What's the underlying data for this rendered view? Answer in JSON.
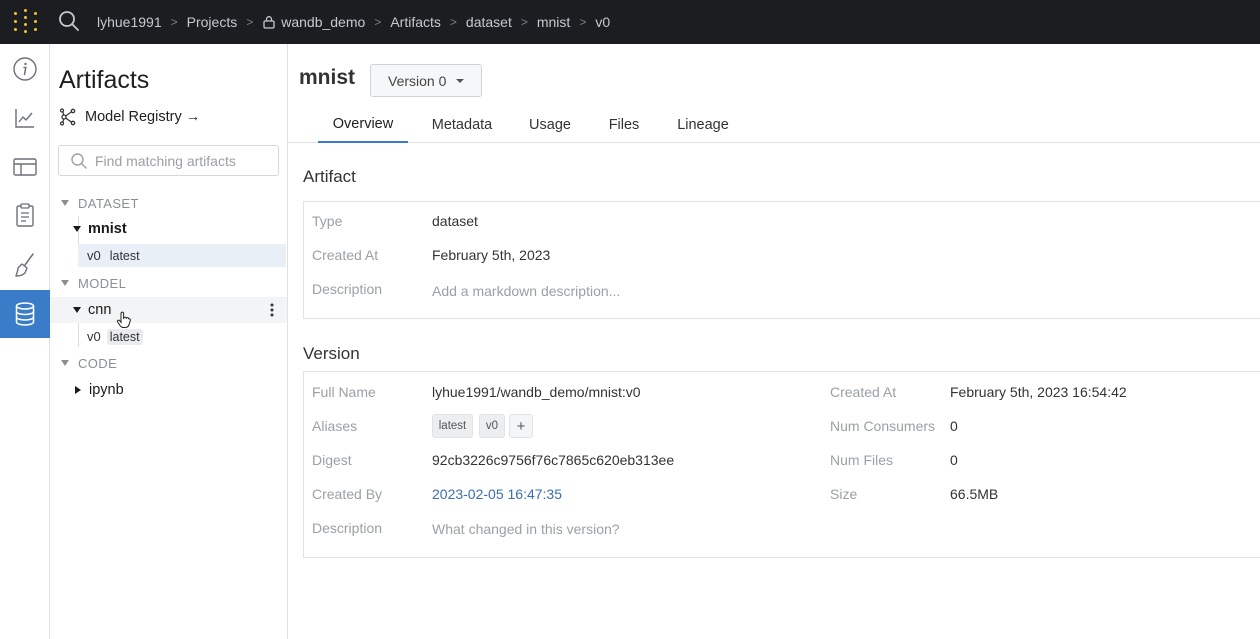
{
  "breadcrumbs": {
    "user": "lyhue1991",
    "projects": "Projects",
    "project": "wandb_demo",
    "artifacts": "Artifacts",
    "type": "dataset",
    "name": "mnist",
    "version": "v0",
    "separator": ">"
  },
  "rail": {
    "icons": [
      "info-icon",
      "chart-line-icon",
      "table-icon",
      "report-icon",
      "sweep-brush-icon",
      "database-icon"
    ],
    "active": "database-icon",
    "accent": "#3a7cc8"
  },
  "sidebar": {
    "title": "Artifacts",
    "registry_label": "Model Registry",
    "registry_arrow": "→",
    "search_placeholder": "Find matching artifacts",
    "groups": [
      {
        "label": "DATASET",
        "items": [
          {
            "name": "mnist",
            "expanded": true,
            "versions": [
              {
                "version": "v0",
                "alias": "latest",
                "selected": true
              }
            ]
          }
        ]
      },
      {
        "label": "MODEL",
        "items": [
          {
            "name": "cnn",
            "expanded": true,
            "versions": [
              {
                "version": "v0",
                "alias": "latest",
                "selected": false
              }
            ]
          }
        ]
      },
      {
        "label": "CODE",
        "items": [
          {
            "name": "ipynb",
            "expanded": false,
            "versions": []
          }
        ]
      }
    ]
  },
  "header": {
    "artifact_name": "mnist",
    "version_select": "Version 0"
  },
  "tabs": [
    "Overview",
    "Metadata",
    "Usage",
    "Files",
    "Lineage"
  ],
  "active_tab": "Overview",
  "artifact_section": {
    "title": "Artifact",
    "type_label": "Type",
    "type_value": "dataset",
    "created_label": "Created At",
    "created_value": "February 5th, 2023",
    "description_label": "Description",
    "description_placeholder": "Add a markdown description..."
  },
  "version_section": {
    "title": "Version",
    "full_name_label": "Full Name",
    "full_name_value": "lyhue1991/wandb_demo/mnist:v0",
    "aliases_label": "Aliases",
    "aliases": [
      "latest",
      "v0"
    ],
    "add_alias": "+",
    "digest_label": "Digest",
    "digest_value": "92cb3226c9756f76c7865c620eb313ee",
    "created_by_label": "Created By",
    "created_by_value": "2023-02-05 16:47:35",
    "description_label": "Description",
    "description_placeholder": "What changed in this version?",
    "created_at_label": "Created At",
    "created_at_value": "February 5th, 2023 16:54:42",
    "consumers_label": "Num Consumers",
    "consumers_value": "0",
    "files_label": "Num Files",
    "files_value": "0",
    "size_label": "Size",
    "size_value": "66.5MB"
  }
}
